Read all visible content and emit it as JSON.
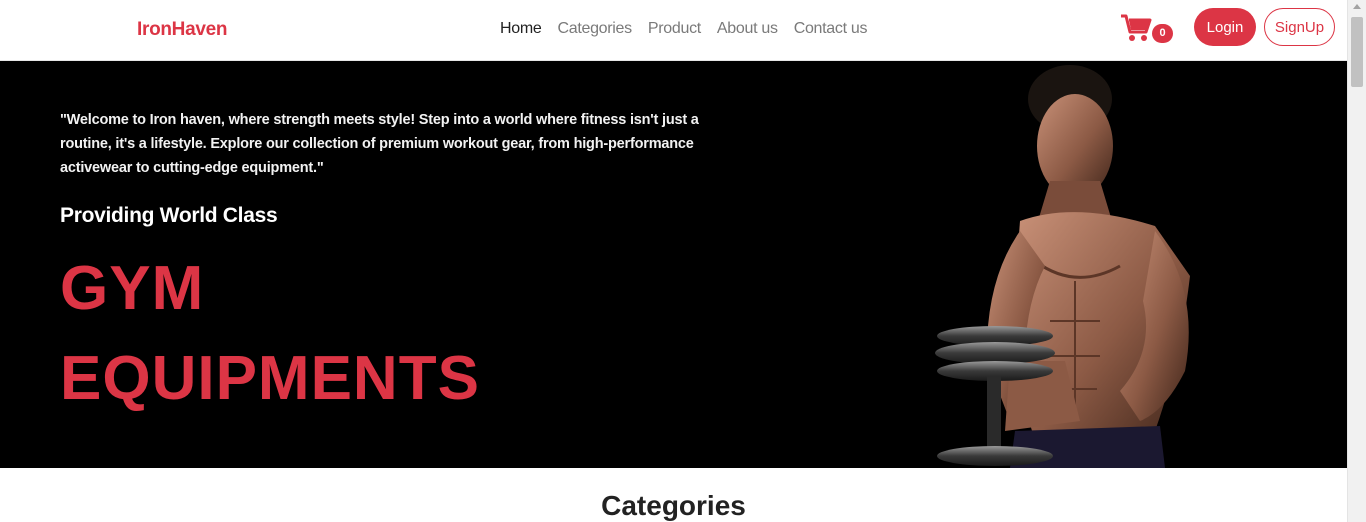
{
  "navbar": {
    "brand": "IronHaven",
    "links": [
      {
        "label": "Home",
        "active": true
      },
      {
        "label": "Categories",
        "active": false
      },
      {
        "label": "Product",
        "active": false
      },
      {
        "label": "About us",
        "active": false
      },
      {
        "label": "Contact us",
        "active": false
      }
    ],
    "cart_count": "0",
    "login_label": "Login",
    "signup_label": "SignUp"
  },
  "hero": {
    "quote": "\"Welcome to Iron haven, where strength meets style! Step into a world where fitness isn't just a routine, it's a lifestyle. Explore our collection of premium workout gear, from high-performance activewear to cutting-edge equipment.\"",
    "subtitle": "Providing World Class",
    "title_line1": "GYM",
    "title_line2": "EQUIPMENTS"
  },
  "categories": {
    "heading": "Categories"
  },
  "colors": {
    "accent": "#dc3545",
    "hero_bg": "#000000"
  },
  "icons": [
    "cart-icon"
  ]
}
